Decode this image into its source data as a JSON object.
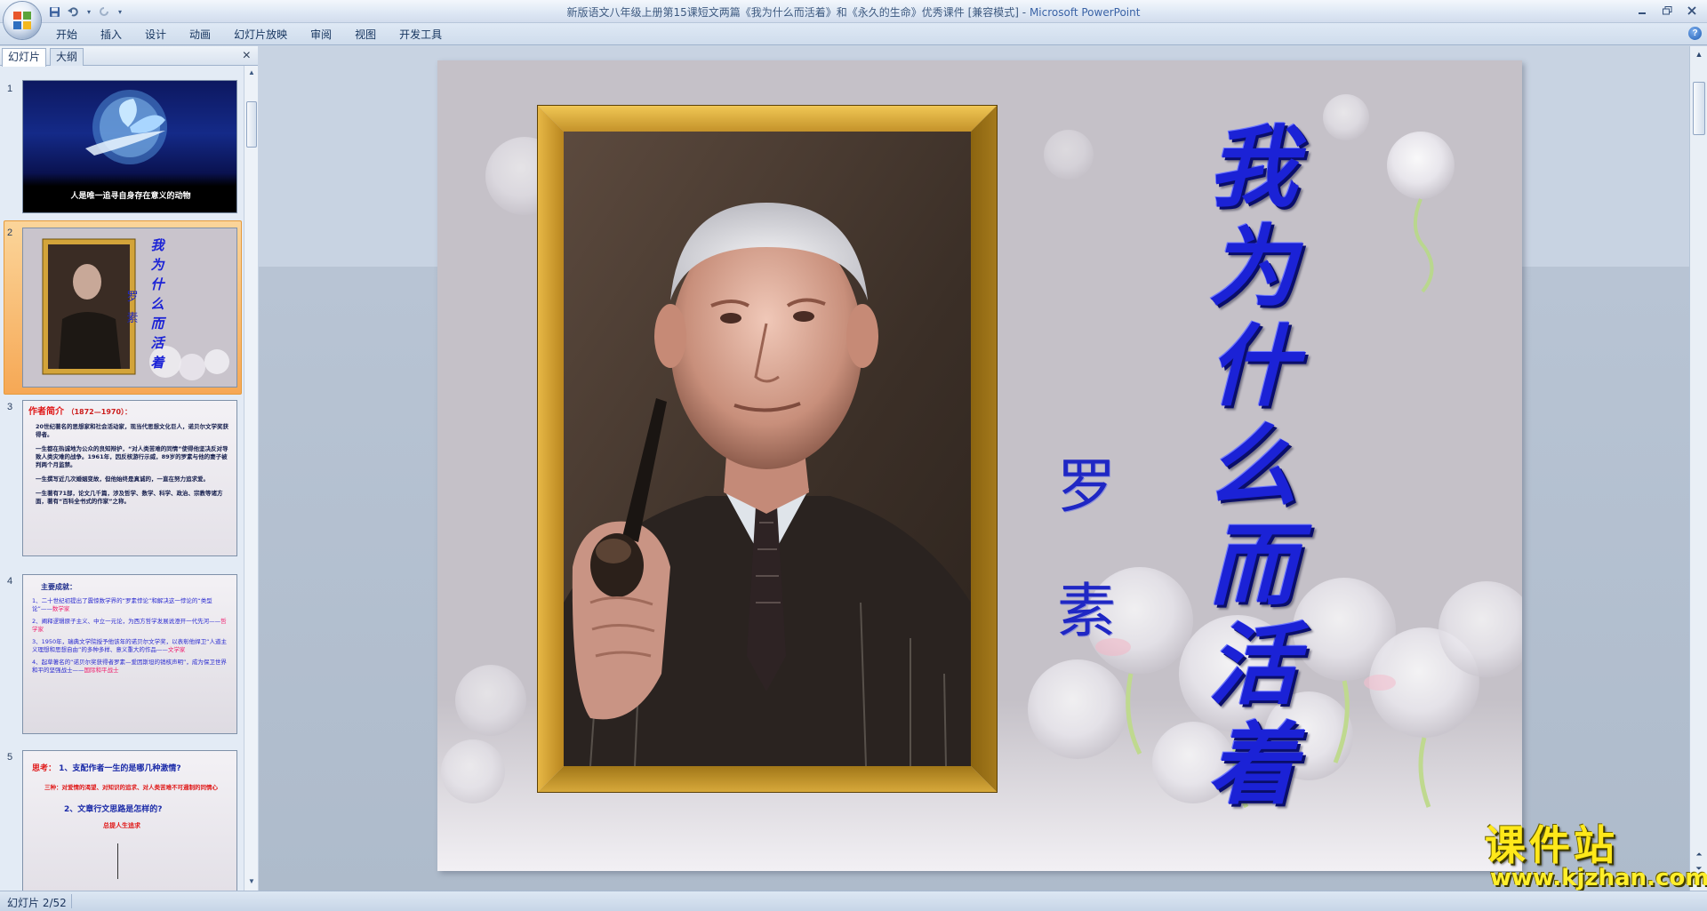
{
  "window": {
    "title": "新版语文八年级上册第15课短文两篇《我为什么而活着》和《永久的生命》优秀课件 [兼容模式] - ",
    "app_name": "Microsoft PowerPoint"
  },
  "ribbon": {
    "tabs": [
      "开始",
      "插入",
      "设计",
      "动画",
      "幻灯片放映",
      "审阅",
      "视图",
      "开发工具"
    ]
  },
  "panel": {
    "tab_slides": "幻灯片",
    "tab_outline": "大纲",
    "close": "×"
  },
  "thumbnails": [
    {
      "number": "1",
      "caption": "人是唯一追寻自身存在意义的动物"
    },
    {
      "number": "2",
      "title": "我为什么而活着",
      "author": "罗 素",
      "selected": true
    },
    {
      "number": "3",
      "heading": "作者简介",
      "heading_dates": "（1872—1970）：",
      "bullets": [
        "20世纪著名的思想家和社会活动家，现当代思想文化巨人，诺贝尔文学奖获得者。",
        "一生都在热诚地为公众的良知辩护，“对人类苦难的同情”使得他坚决反对导致人类灾难的战争。1961年，因反核游行示威，89岁的罗素与他的妻子被判两个月监禁。",
        "一生撰写近几次婚姻变故，但他始终是真诚的，一直在努力追求爱。",
        "一生著有71部，论文几千篇，涉及哲学、数学、科学、政治、宗教等诸方面，著有“百科全书式的作家”之称。"
      ]
    },
    {
      "number": "4",
      "heading": "主要成就：",
      "items": [
        {
          "text": "1、二十世纪初提出了震惊数学界的“罗素悖论”和解决这一悖论的“类型论”——",
          "tag": "数学家"
        },
        {
          "text": "2、阐释逻辑原子主义、中立一元论，为西方哲学发展说澄开一代先河——",
          "tag": "哲学家"
        },
        {
          "text": "3、1950年，瑞典文学院授予他该年的诺贝尔文学奖，以表彰他捍卫“人道主义理想和思想自由”的多种多样、意义重大的作品——",
          "tag": "文学家"
        },
        {
          "text": "4、起草著名的“诺贝尔奖获得者罗素—爱因斯坦的销核声明”，成为保卫世界和平的坚强战士——",
          "tag": "国际和平战士"
        }
      ]
    },
    {
      "number": "5",
      "label": "思考：",
      "q1": "1、支配作者一生的是哪几种激情?",
      "a1": "三种：对爱情的渴望、对知识的追求、对人类苦难不可遏制的同情心",
      "q2": "2、文章行文思路是怎样的?",
      "a2": "总提人生追求"
    }
  ],
  "slide": {
    "title_chars": [
      "我",
      "为",
      "什",
      "么",
      "而",
      "活",
      "着"
    ],
    "author_chars": [
      "罗",
      "素"
    ]
  },
  "watermark": {
    "text": "课件站",
    "url": "www.kjzhan.com"
  },
  "status": {
    "slide_indicator": "幻灯片 2/52"
  },
  "colors": {
    "title_blue": "#1b22d6",
    "frame_gold": "#d7a836",
    "selection_orange": "#f6a855",
    "ribbon_bg": "#dfe9f5"
  }
}
